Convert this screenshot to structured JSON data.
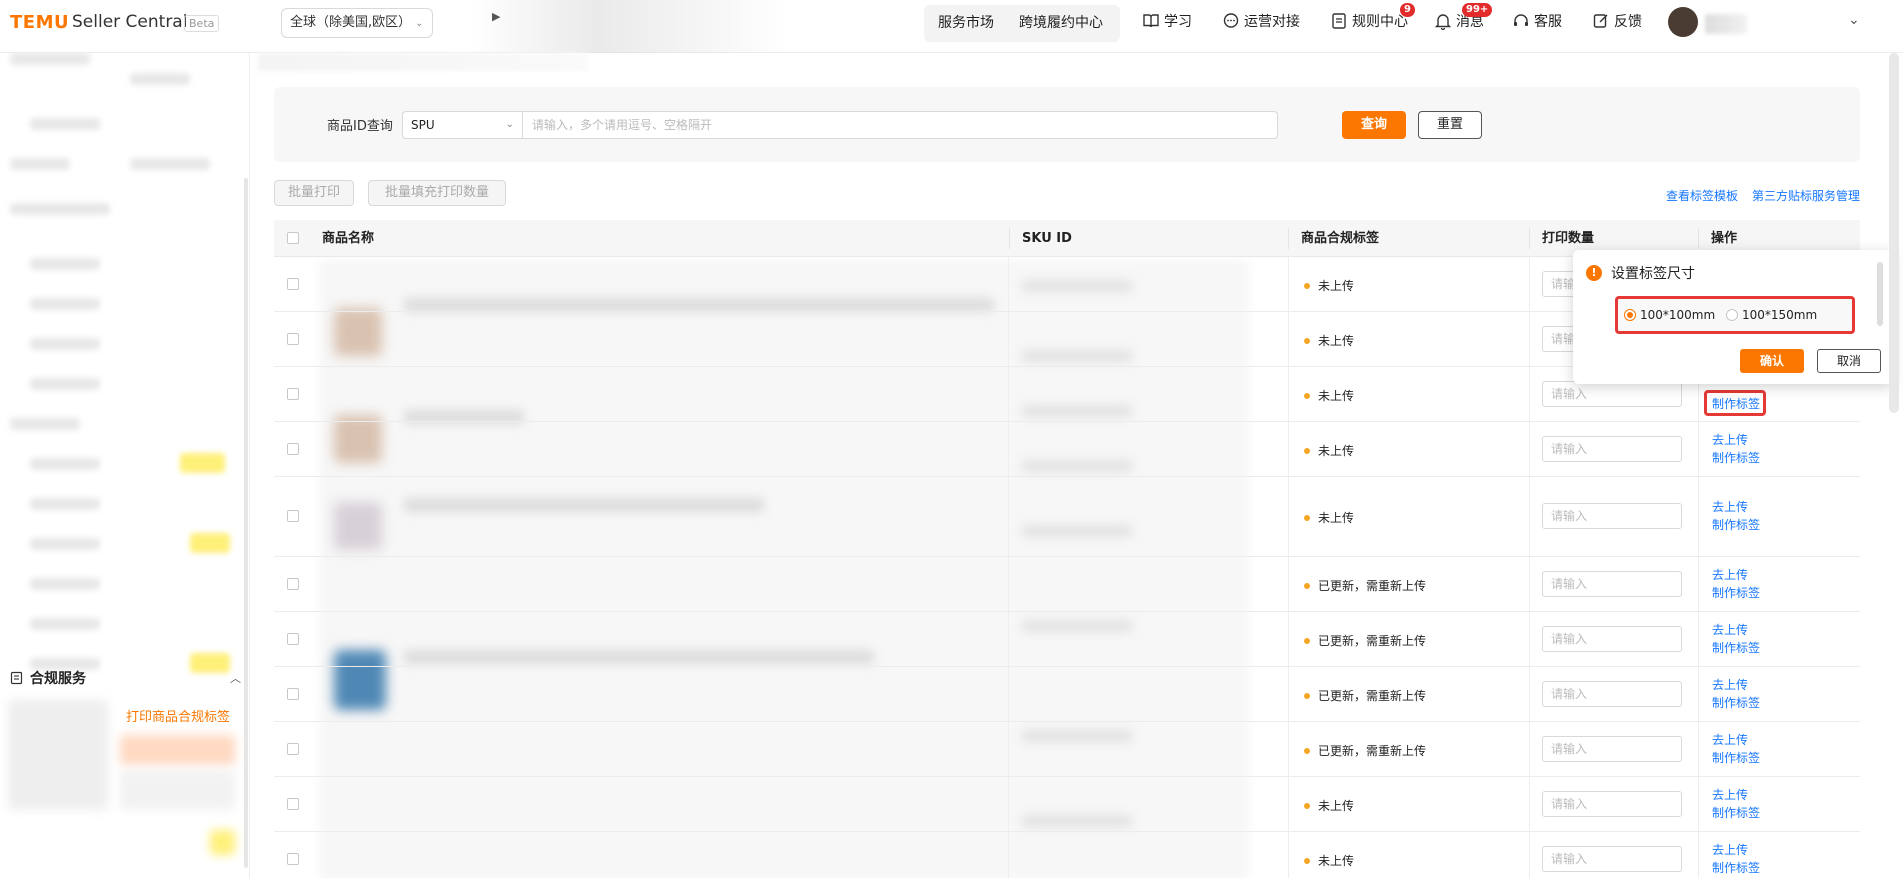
{
  "header": {
    "logo": "TEMU",
    "logo_sub": "Seller Central",
    "beta": "Beta",
    "region": "全球（除美国,欧区）",
    "nav_market": "服务市场",
    "nav_cross": "跨境履约中心",
    "learn": "学习",
    "ops": "运营对接",
    "rules": "规则中心",
    "rules_badge": "9",
    "msg": "消息",
    "msg_badge": "99+",
    "service": "客服",
    "feedback": "反馈"
  },
  "sidebar": {
    "section": "合规服务",
    "active_item": "打印商品合规标签"
  },
  "filter": {
    "label": "商品ID查询",
    "select_value": "SPU",
    "input_placeholder": "请输入，多个请用逗号、空格隔开",
    "query": "查询",
    "reset": "重置"
  },
  "toolbar": {
    "batch_print": "批量打印",
    "batch_fill": "批量填充打印数量",
    "view_template": "查看标签模板",
    "third_party": "第三方贴标服务管理"
  },
  "table": {
    "headers": [
      "商品名称",
      "SKU ID",
      "商品合规标签",
      "打印数量",
      "操作"
    ],
    "qty_placeholder": "请输入",
    "op_upload": "去上传",
    "op_make": "制作标签",
    "rows": [
      {
        "status": "未上传"
      },
      {
        "status": "未上传"
      },
      {
        "status": "未上传"
      },
      {
        "status": "未上传"
      },
      {
        "status": "未上传"
      },
      {
        "status": "已更新，需重新上传"
      },
      {
        "status": "已更新，需重新上传"
      },
      {
        "status": "已更新，需重新上传"
      },
      {
        "status": "已更新，需重新上传"
      },
      {
        "status": "未上传"
      },
      {
        "status": "未上传"
      }
    ]
  },
  "popover": {
    "title": "设置标签尺寸",
    "option1": "100*100mm",
    "option2": "100*150mm",
    "selected": "100*100mm",
    "ok": "确认",
    "cancel": "取消"
  },
  "colors": {
    "brand": "#fb7701",
    "link": "#1677ff",
    "highlight": "#e53935",
    "status_dot": "#f5a623"
  }
}
